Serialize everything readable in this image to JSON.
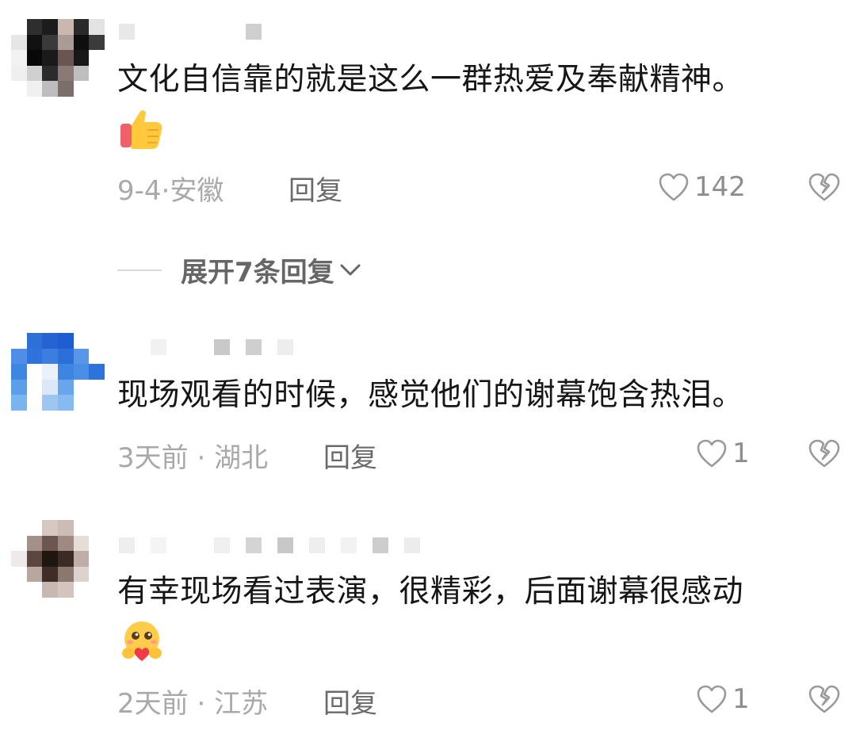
{
  "comments": [
    {
      "text": "文化自信靠的就是这么一群热爱及奉献精神。",
      "emoji": "thumbs-up-icon",
      "date": "9-4",
      "separator": "·",
      "location": "安徽",
      "reply_label": "回复",
      "like_count": "142",
      "avatar_colors": [
        "#ffffff",
        "#2e2e2e",
        "#1c1c1c",
        "#c9b7b0",
        "#2a2a2a",
        "#e3e3e3",
        "#e6e6e6",
        "#111111",
        "#3a3a3a",
        "#a99b95",
        "#0e0e0e",
        "#3b3b3b",
        "#f2f2f2",
        "#080808",
        "#1a1a1a",
        "#6b5550",
        "#181818",
        "#ffffff",
        "#efefef",
        "#d0d0d0",
        "#2b2b2b",
        "#8a7a76",
        "#bfbfbf",
        "#ffffff",
        "#ffffff",
        "#f0f0f0",
        "#bdbdbd",
        "#7a6f6b",
        "#ffffff",
        "#ffffff"
      ]
    },
    {
      "text": "现场观看的时候，感觉他们的谢幕饱含热泪。",
      "date": "3天前",
      "separator": "·",
      "location": "湖北",
      "reply_label": "回复",
      "like_count": "1",
      "avatar_colors": [
        "#ffffff",
        "#2f6fd8",
        "#2563d4",
        "#1f5ed2",
        "#ffffff",
        "#ffffff",
        "#4f8de6",
        "#2e73dc",
        "#3a7fe0",
        "#2b6fd9",
        "#5a96e8",
        "#ffffff",
        "#3d86e2",
        "#ffffff",
        "#e9f1fb",
        "#3c85e1",
        "#4a8fe5",
        "#2c74dc",
        "#5b9eea",
        "#ffffff",
        "#dbe8f8",
        "#69a5ec",
        "#ffffff",
        "#ffffff",
        "#7ab4f0",
        "#ffffff",
        "#9dc6f3",
        "#86baf1",
        "#ffffff",
        "#ffffff"
      ]
    },
    {
      "text": "有幸现场看过表演，很精彩，后面谢幕很感动",
      "emoji": "hugging-face-icon",
      "date": "2天前",
      "separator": "·",
      "location": "江苏",
      "reply_label": "回复",
      "like_count": "1",
      "avatar_colors": [
        "#ffffff",
        "#ffffff",
        "#d7c8c2",
        "#cbbcb6",
        "#ffffff",
        "#ffffff",
        "#ffffff",
        "#a39088",
        "#6b574f",
        "#9c8a83",
        "#e6dcd8",
        "#ffffff",
        "#efe9e7",
        "#5c4740",
        "#1f1511",
        "#3b2b25",
        "#bfaea8",
        "#ffffff",
        "#ffffff",
        "#b9a69e",
        "#3f2e28",
        "#8a7770",
        "#ded2ce",
        "#ffffff",
        "#ffffff",
        "#ffffff",
        "#c8b8b2",
        "#d3c4be",
        "#ffffff",
        "#ffffff"
      ]
    }
  ],
  "expand_replies": {
    "label": "展开7条回复"
  },
  "colors": {
    "text_primary": "#161616",
    "text_meta": "#a9a9a9",
    "text_reply": "#6a6a6a",
    "icon_gray": "#9a9a9a",
    "username_placeholder": "#d6d6d6"
  }
}
